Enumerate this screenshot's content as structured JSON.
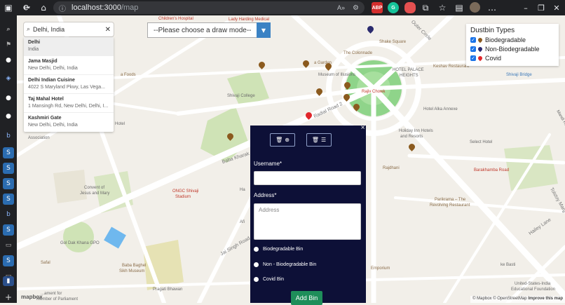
{
  "browser": {
    "url_host": "localhost:3000",
    "url_path": "/map",
    "extensions": [
      {
        "name": "adblock",
        "label": "ABP",
        "color": "#d42e2e"
      },
      {
        "name": "grammarly",
        "label": "G",
        "color": "#15c39a"
      },
      {
        "name": "shield",
        "label": "",
        "color": "#e45050"
      }
    ]
  },
  "search": {
    "value": "Delhi, India",
    "results": [
      {
        "title": "Delhi",
        "subtitle": "India"
      },
      {
        "title": "Jama Masjid",
        "subtitle": "New Delhi, Delhi, India"
      },
      {
        "title": "Delhi Indian Cuisine",
        "subtitle": "4022 S Maryland Pkwy, Las Vega..."
      },
      {
        "title": "Taj Mahal Hotel",
        "subtitle": "1 Mansingh Rd, New Delhi, Delhi, I..."
      },
      {
        "title": "Kashmiri Gate",
        "subtitle": "New Delhi, Delhi, India"
      }
    ]
  },
  "draw_mode": {
    "selected": "--Please choose a draw mode--"
  },
  "legend": {
    "title": "Dustbin Types",
    "items": [
      {
        "label": "Biodegradable",
        "color": "#8b5a1e",
        "checked": true
      },
      {
        "label": "Non-Biodegradable",
        "color": "#2a2a6e",
        "checked": true
      },
      {
        "label": "Covid",
        "color": "#e0262b",
        "checked": true
      }
    ]
  },
  "form": {
    "username_label": "Username*",
    "username_value": "",
    "address_label": "Address*",
    "address_placeholder": "Address",
    "radio_options": [
      "Biodegradable Bin",
      "Non - Biodegradable Bin",
      "Covid Bin"
    ],
    "submit_label": "Add Bin",
    "close_glyph": "×"
  },
  "map_labels": {
    "childrens_hospital": "Children's Hospital",
    "lady_harding": "Lady Harding Medical",
    "outer_circle": "Outer Circle",
    "the_colonnade": "The Colonnade",
    "shake_square": "Shake Square",
    "keshav": "Keshav Restaurant",
    "shivaji_bridge": "Shivaji Bridge",
    "hotel_palace": "HOTEL PALACE",
    "heights": "HEIGHTS",
    "rajiv_chowk": "Rajiv Chowk",
    "museum": "Museum of Illusions",
    "radial_road": "Radial Road 2",
    "shivaji_college": "Shivaji College",
    "hotel_alka": "Hotel Alka Annexe",
    "a_foods": "a Foods",
    "a_garden": "a Garden",
    "holiday_inn": "Holiday Inn Hotels",
    "and_resorts": "and Resorts",
    "select_hotel": "Select Hotel",
    "barakhamba": "Barakhamba Road",
    "rajdhani": "Rajdhani",
    "parikrama_1": "Parikrama – The",
    "parikrama_2": "Revolving Restaurant",
    "baba_kharak": "Baba Kharak",
    "convent_1": "Convent of",
    "convent_2": "Jesus and Mary",
    "ongc_1": "ONGC Shivaji",
    "ongc_2": "Stadium",
    "gol_dak": "Gol Dak Khana GPO",
    "jai_singh": "Jai Singh Road",
    "baba_baghel_1": "Baba Baghel",
    "baba_baghel_2": "Sikh Museum",
    "safal": "Safal",
    "pragati": "Pragati Bhawan",
    "emporium": "Emporium",
    "ke_basti": "ke Basti",
    "us_india_1": "United-States-India",
    "us_india_2": "Educational Foundation",
    "hailey": "Hailey Lane",
    "tolstoy": "Tolstoy Marg",
    "mandi": "Mandi House",
    "hotel_short": "Hotel",
    "association": "Association",
    "parliament": "...ament for",
    "member_parl": "Member of Parliament",
    "afi": "Afi",
    "ha": "Ha"
  },
  "attribution": {
    "text": "© Mapbox © OpenStreetMap",
    "improve": "Improve this map",
    "logo": "mapbox"
  }
}
